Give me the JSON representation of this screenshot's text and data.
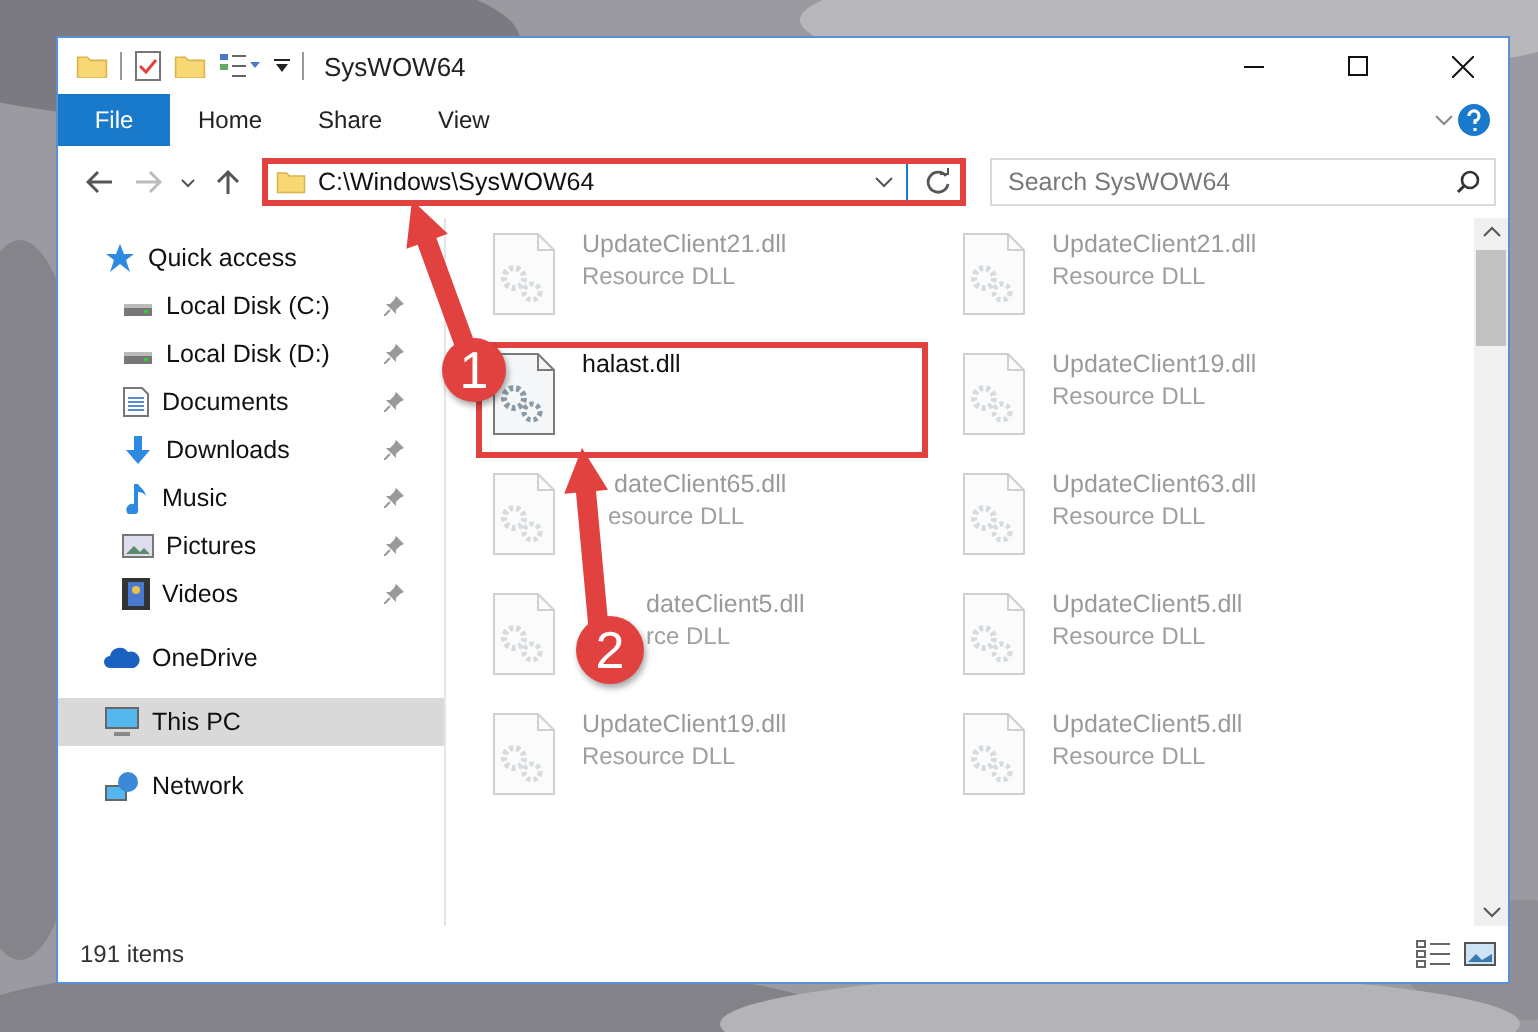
{
  "window": {
    "title": "SysWOW64"
  },
  "ribbon_tabs": [
    {
      "label": "File",
      "kind": "menu"
    },
    {
      "label": "Home",
      "kind": "tab"
    },
    {
      "label": "Share",
      "kind": "tab"
    },
    {
      "label": "View",
      "kind": "tab"
    }
  ],
  "address_bar": {
    "path": "C:\\Windows\\SysWOW64",
    "highlighted": true
  },
  "search": {
    "placeholder": "Search SysWOW64"
  },
  "sidebar": {
    "items": [
      {
        "label": "Quick access",
        "selected": false,
        "children": [
          {
            "label": "Local Disk (C:)",
            "pinned": true,
            "selected": false
          },
          {
            "label": "Local Disk (D:)",
            "pinned": true,
            "selected": false
          },
          {
            "label": "Documents",
            "pinned": true,
            "selected": false
          },
          {
            "label": "Downloads",
            "pinned": true,
            "selected": false
          },
          {
            "label": "Music",
            "pinned": true,
            "selected": false
          },
          {
            "label": "Pictures",
            "pinned": true,
            "selected": false
          },
          {
            "label": "Videos",
            "pinned": true,
            "selected": false
          }
        ]
      },
      {
        "label": "OneDrive",
        "selected": false
      },
      {
        "label": "This PC",
        "selected": true
      },
      {
        "label": "Network",
        "selected": false
      }
    ]
  },
  "files": [
    {
      "name": "UpdateClient21.dll",
      "type": "Resource DLL",
      "faded": true,
      "highlighted": false
    },
    {
      "name": "UpdateClient21.dll",
      "type": "Resource DLL",
      "faded": true,
      "highlighted": false
    },
    {
      "name": "halast.dll",
      "faded": false,
      "highlighted": true
    },
    {
      "name": "UpdateClient19.dll",
      "type": "Resource DLL",
      "faded": true,
      "highlighted": false
    },
    {
      "name": "dateClient65.dll",
      "type": "esource DLL",
      "faded": true,
      "highlighted": false
    },
    {
      "name": "UpdateClient63.dll",
      "type": "Resource DLL",
      "faded": true,
      "highlighted": false
    },
    {
      "name": "dateClient5.dll",
      "type": "rce DLL",
      "faded": true,
      "highlighted": false
    },
    {
      "name": "UpdateClient5.dll",
      "type": "Resource DLL",
      "faded": true,
      "highlighted": false
    },
    {
      "name": "UpdateClient19.dll",
      "type": "Resource DLL",
      "faded": true,
      "highlighted": false
    },
    {
      "name": "UpdateClient5.dll",
      "type": "Resource DLL",
      "faded": true,
      "highlighted": false
    }
  ],
  "status_bar": {
    "item_count": "191 items"
  },
  "annotations": [
    {
      "number": "1"
    },
    {
      "number": "2"
    }
  ]
}
